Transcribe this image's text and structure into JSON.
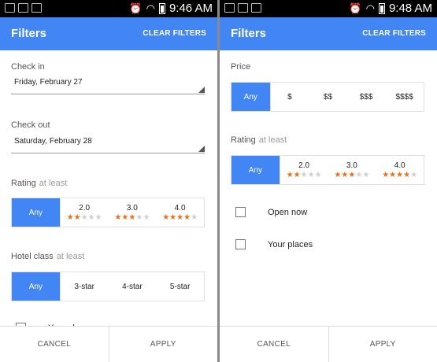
{
  "left": {
    "status": {
      "time": "9:46 AM"
    },
    "appbar": {
      "title": "Filters",
      "clear": "CLEAR FILTERS"
    },
    "checkin": {
      "label": "Check in",
      "value": "Friday, February 27"
    },
    "checkout": {
      "label": "Check out",
      "value": "Saturday, February 28"
    },
    "rating": {
      "label": "Rating",
      "sub": "at least",
      "any": "Any",
      "options": [
        {
          "label": "2.0",
          "stars": 2
        },
        {
          "label": "3.0",
          "stars": 3
        },
        {
          "label": "4.0",
          "stars": 4
        }
      ]
    },
    "hotel": {
      "label": "Hotel class",
      "sub": "at least",
      "options": [
        "Any",
        "3-star",
        "4-star",
        "5-star"
      ]
    },
    "your_places": "Your places",
    "footer": {
      "cancel": "CANCEL",
      "apply": "APPLY"
    }
  },
  "right": {
    "status": {
      "time": "9:48 AM"
    },
    "appbar": {
      "title": "Filters",
      "clear": "CLEAR FILTERS"
    },
    "price": {
      "label": "Price",
      "options": [
        "Any",
        "$",
        "$$",
        "$$$",
        "$$$$"
      ]
    },
    "rating": {
      "label": "Rating",
      "sub": "at least",
      "any": "Any",
      "options": [
        {
          "label": "2.0",
          "stars": 2
        },
        {
          "label": "3.0",
          "stars": 3
        },
        {
          "label": "4.0",
          "stars": 4
        }
      ]
    },
    "open_now": "Open now",
    "your_places": "Your places",
    "footer": {
      "cancel": "CANCEL",
      "apply": "APPLY"
    }
  },
  "colors": {
    "accent": "#4285f4",
    "star": "#e8711c",
    "star_off": "#d0d0d0"
  }
}
